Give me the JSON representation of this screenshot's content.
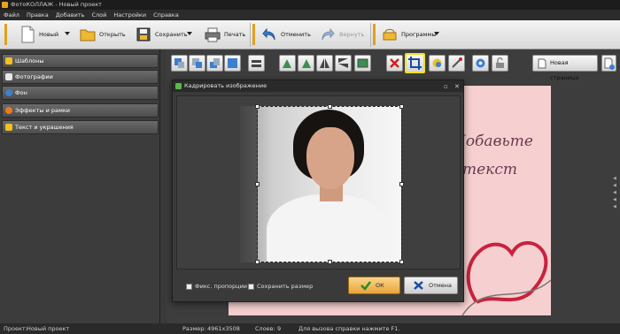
{
  "window": {
    "title": "ФотоКОЛЛАЖ - Новый проект"
  },
  "menu": [
    "Файл",
    "Правка",
    "Добавить",
    "Слой",
    "Настройки",
    "Справка"
  ],
  "toolbar": {
    "new_label": "Новый",
    "open_label": "Открыть",
    "save_label": "Сохранить",
    "print_label": "Печать",
    "undo_label": "Отменить",
    "redo_label": "Вернуть",
    "programs_label": "Программы",
    "accent_color": "#e0a020"
  },
  "left_panel": {
    "items": [
      {
        "label": "Шаблоны",
        "icon": "star-icon"
      },
      {
        "label": "Фотографии",
        "icon": "photo-icon"
      },
      {
        "label": "Фон",
        "icon": "globe-icon"
      },
      {
        "label": "Эффекты и рамки",
        "icon": "effects-icon"
      },
      {
        "label": "Текст и украшения",
        "icon": "text-icon"
      }
    ]
  },
  "canvas_toolbar": {
    "new_page_label": "Новая страница"
  },
  "canvas": {
    "line1": "Добавьте",
    "line2": "текст",
    "background_color": "#f6d0d0"
  },
  "dialog": {
    "title": "Кадрировать изображение",
    "fix_proportions_label": "Фикс. пропорции",
    "keep_size_label": "Сохранить размер",
    "ok_label": "ОК",
    "cancel_label": "Отмена"
  },
  "status": {
    "project_label": "Проект:",
    "project_value": "Новый проект",
    "size_label": "Размер:",
    "size_value": "4961x3508",
    "layers_label": "Слоев:",
    "layers_value": "9",
    "help_text": "Для вызова справки нажмите F1."
  }
}
